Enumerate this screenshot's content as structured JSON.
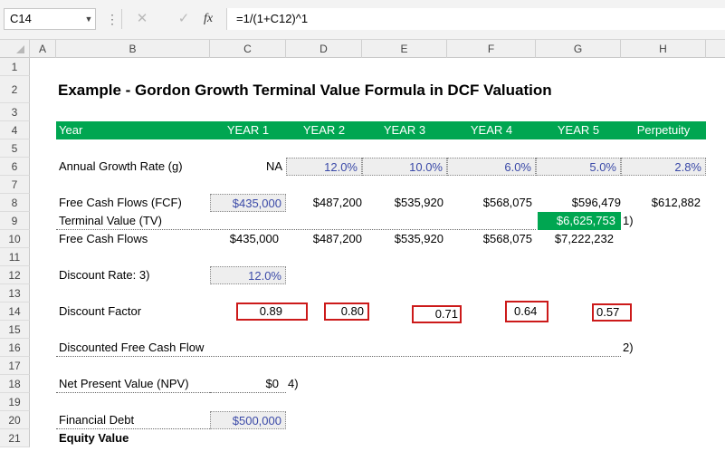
{
  "formula_bar": {
    "name_box": "C14",
    "fx_label": "fx",
    "formula": "=1/(1+C12)^1",
    "dots": "⋮",
    "cancel_icon": "✕",
    "enter_icon": "✓",
    "dropdown_icon": "▼"
  },
  "columns": [
    "A",
    "B",
    "C",
    "D",
    "E",
    "F",
    "G",
    "H"
  ],
  "rows": [
    "1",
    "2",
    "3",
    "4",
    "5",
    "6",
    "7",
    "8",
    "9",
    "10",
    "11",
    "12",
    "13",
    "14",
    "15",
    "16",
    "17",
    "18",
    "19",
    "20",
    "21"
  ],
  "sheet": {
    "title": "Example - Gordon Growth Terminal Value Formula in DCF Valuation",
    "header": {
      "label": "Year",
      "years": [
        "YEAR 1",
        "YEAR 2",
        "YEAR 3",
        "YEAR 4",
        "YEAR 5"
      ],
      "perpetuity": "Perpetuity"
    },
    "growth": {
      "label": "Annual Growth Rate (g)",
      "values": [
        "NA",
        "12.0%",
        "10.0%",
        "6.0%",
        "5.0%",
        "2.8%"
      ]
    },
    "fcf": {
      "label": "Free Cash Flows (FCF)",
      "values": [
        "$435,000",
        "$487,200",
        "$535,920",
        "$568,075",
        "$596,479",
        "$612,882"
      ]
    },
    "terminal": {
      "label": "Terminal Value (TV)",
      "value": "$6,625,753",
      "note": "1)"
    },
    "fcf_total": {
      "label": "Free Cash Flows",
      "values": [
        "$435,000",
        "$487,200",
        "$535,920",
        "$568,075",
        "$7,222,232"
      ]
    },
    "discount_rate": {
      "label": "Discount Rate: 3)",
      "value": "12.0%"
    },
    "discount_factor": {
      "label": "Discount Factor",
      "values": [
        "0.89",
        "0.80",
        "0.71",
        "0.64",
        "0.57"
      ]
    },
    "discounted_fcf": {
      "label": "Discounted Free Cash Flow",
      "note": "2)"
    },
    "npv": {
      "label": "Net Present Value (NPV)",
      "value": "$0",
      "note": "4)"
    },
    "debt": {
      "label": "Financial Debt",
      "value": "$500,000"
    },
    "equity": {
      "label": "Equity Value"
    }
  },
  "colors": {
    "header_green": "#00a651",
    "input_blue": "#3b4aa8",
    "highlight_red": "#cc1a1a"
  }
}
